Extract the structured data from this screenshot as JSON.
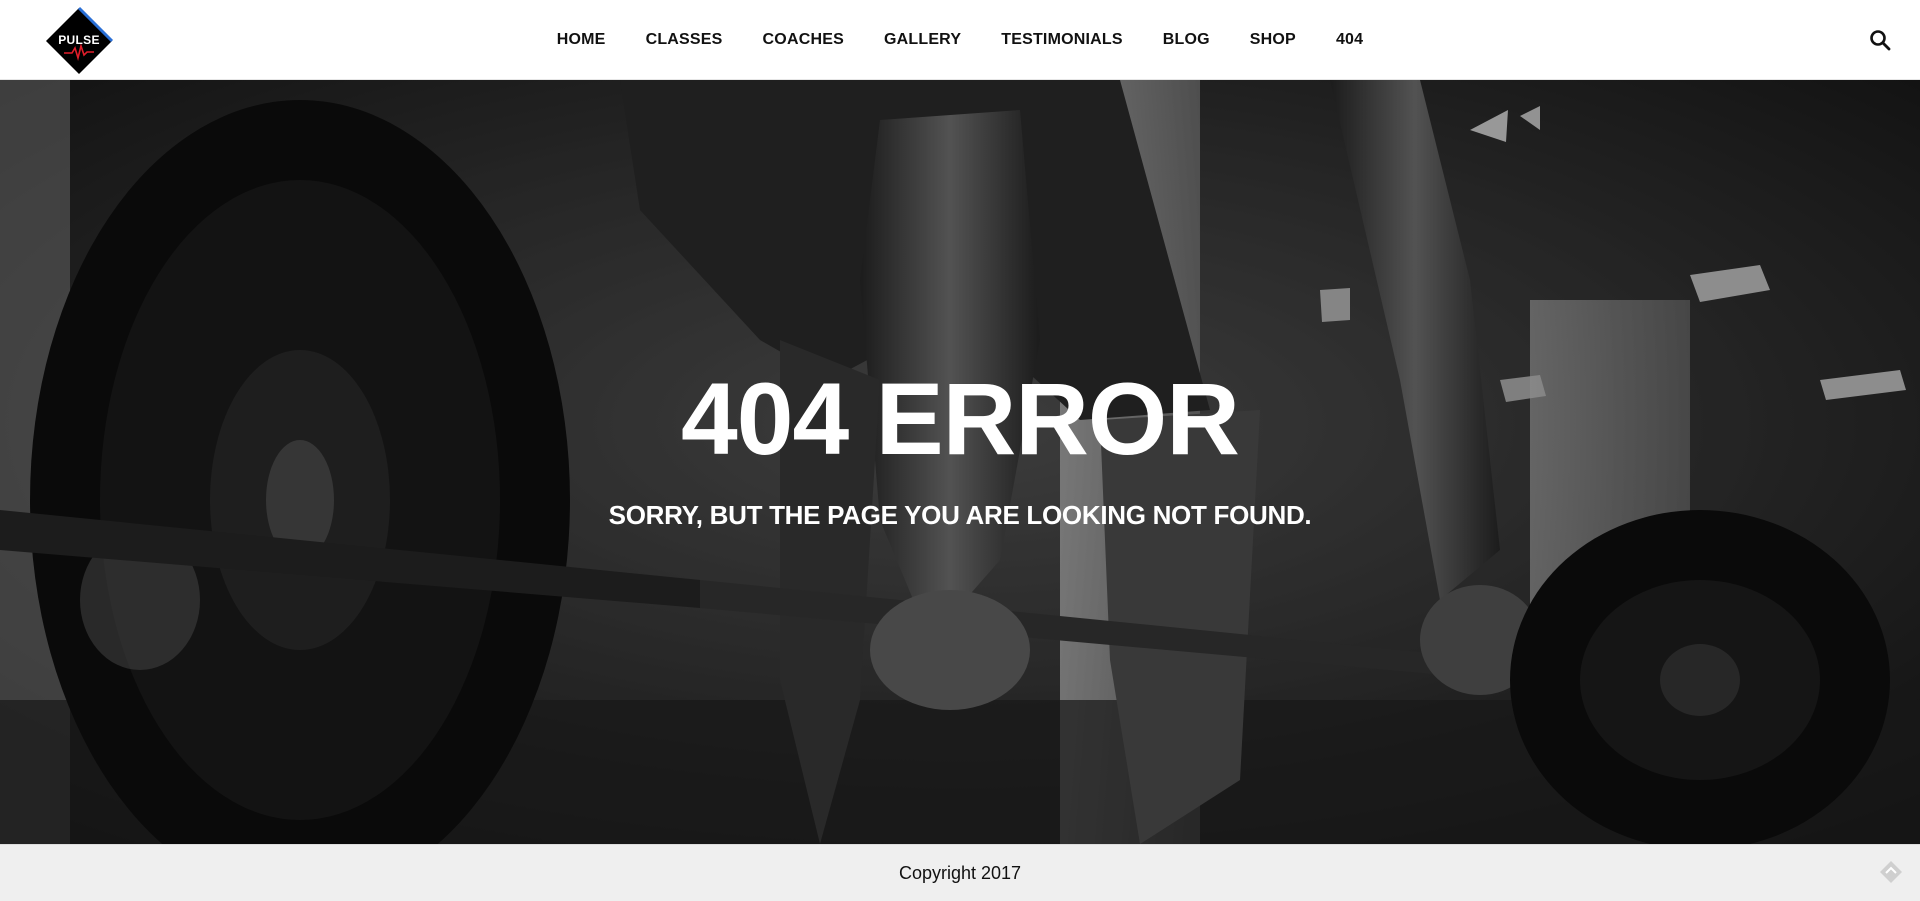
{
  "header": {
    "logo_text": "PULSE",
    "nav_items": [
      "HOME",
      "CLASSES",
      "COACHES",
      "GALLERY",
      "TESTIMONIALS",
      "BLOG",
      "SHOP",
      "404"
    ],
    "search_icon": "search-icon"
  },
  "hero": {
    "title": "404 ERROR",
    "subtitle": "SORRY, BUT THE PAGE YOU ARE LOOKING NOT FOUND.",
    "background": "grayscale gym photo of a person gripping a loaded barbell"
  },
  "footer": {
    "copyright": "Copyright 2017",
    "back_to_top_icon": "arrow-up-icon"
  },
  "colors": {
    "header_bg": "#ffffff",
    "nav_text": "#111111",
    "logo_bg": "#000000",
    "logo_accent": "#2a6fd6",
    "logo_pulse": "#e11d2a",
    "hero_text": "#ffffff",
    "footer_bg": "#efefef"
  }
}
